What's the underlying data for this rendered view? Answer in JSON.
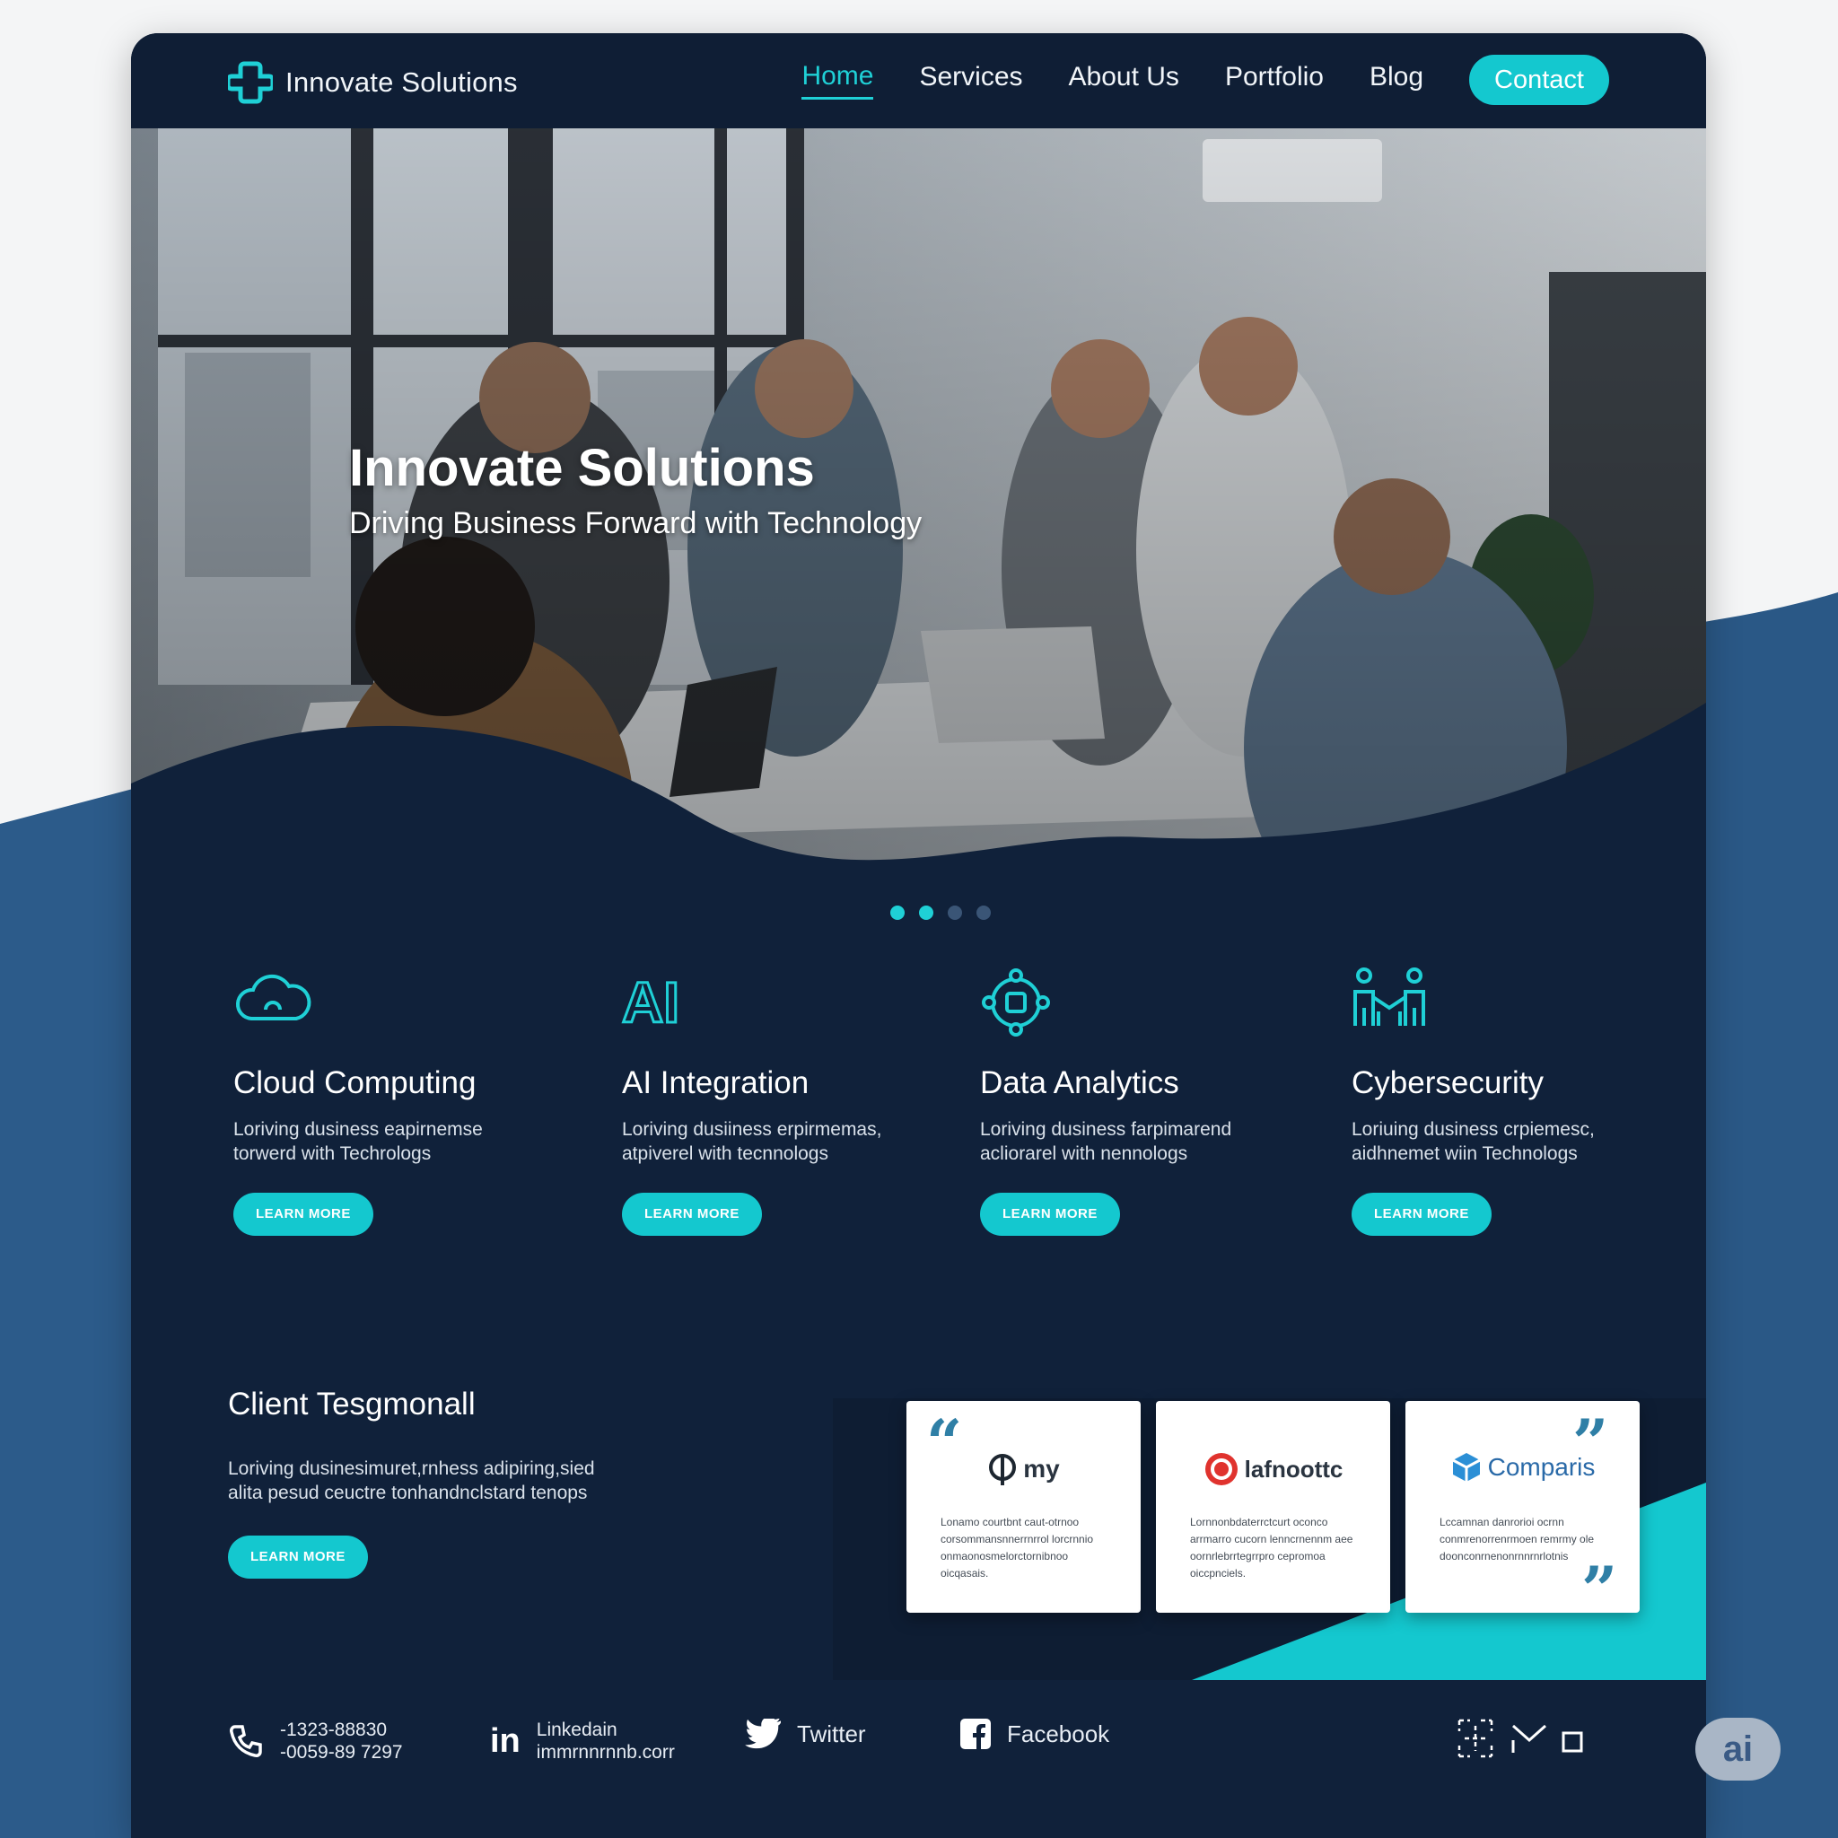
{
  "nav": {
    "brand": "Innovate Solutions",
    "links": [
      "Home",
      "Services",
      "About Us",
      "Portfolio",
      "Blog"
    ],
    "contact_label": "Contact"
  },
  "hero": {
    "title": "Innovate Solutions",
    "subtitle": "Driving Business Forward with Technology",
    "carousel_active_index": 1,
    "carousel_count": 4
  },
  "services": [
    {
      "icon": "cloud-icon",
      "title": "Cloud Computing",
      "desc_1": "Loriving dusiness eapirnemse",
      "desc_2": "torwerd with Techrologs",
      "button": "LEARN MORE"
    },
    {
      "icon": "ai-icon",
      "icon_text": "AI",
      "title": "AI Integration",
      "desc_1": "Loriving dusiiness erpirmemas,",
      "desc_2": "atpiverel with tecnnologs",
      "button": "LEARN MORE"
    },
    {
      "icon": "network-icon",
      "title": "Data Analytics",
      "desc_1": "Loriving dusiness farpimarend",
      "desc_2": "acliorarel with nennologs",
      "button": "LEARN MORE"
    },
    {
      "icon": "people-icon",
      "title": "Cybersecurity",
      "desc_1": "Loriuing dusiness crpiemesc,",
      "desc_2": "aidhnemet wiin Technologs",
      "button": "LEARN MORE"
    }
  ],
  "testimonials": {
    "title": "Client Tesgmonall",
    "desc_1": "Loriving dusinesimuret,rnhess adipiring,sied",
    "desc_2": "alita pesud ceuctre tonhandnclstard tenops",
    "button": "LEARN MORE",
    "cards": [
      {
        "logo": "my",
        "logo_icon": "q-logo-icon",
        "text": "Lonamo courtbnt caut-otrnoo corsommansnnerrnrrol lorcrnnio onmaonosmelorctornibnoo oicqasais."
      },
      {
        "logo": "lafnoottc",
        "logo_icon": "red-circle-logo-icon",
        "text": "Lornnonbdaterrctcurt oconco arrmarro cucorn lenncrnennm aee oornrlebrrtegrrpro cepromoa oiccpnciels."
      },
      {
        "logo": "Comparis",
        "logo_icon": "blue-cube-logo-icon",
        "text": "Lccamnan danrorioi ocrnn conmrenorrenrmoen remrmy ole doonconrnenonrnnrnrlotnis"
      }
    ],
    "quote_open": "“",
    "quote_close": "”"
  },
  "footer": {
    "phone_1": "-1323-88830",
    "phone_2": "-0059-89 7297",
    "linkedin_label": "Linkedain",
    "linkedin_sub": "immrnnrnnb.corr",
    "linkedin_mark": "in",
    "twitter": "Twitter",
    "facebook": "Facebook"
  },
  "badge": "ai",
  "colors": {
    "accent": "#14c8cf",
    "navy": "#10213a",
    "backdrop_blue": "#2a5a88"
  }
}
